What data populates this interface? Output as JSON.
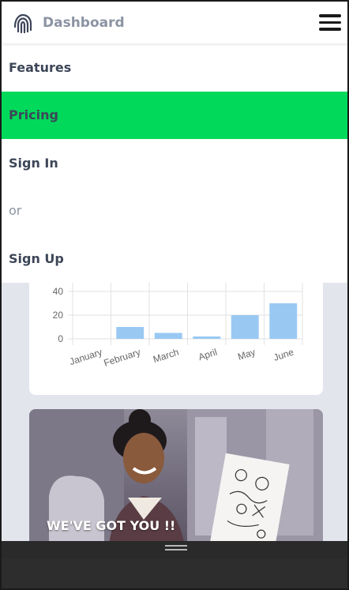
{
  "header": {
    "brand": "Dashboard",
    "logo_icon": "fingerprint-icon",
    "menu_icon": "hamburger-menu-icon"
  },
  "menu": {
    "items": [
      {
        "label": "Features"
      },
      {
        "label": "Pricing",
        "active": true
      },
      {
        "label": "Sign In"
      },
      {
        "label": "or"
      },
      {
        "label": "Sign Up"
      }
    ]
  },
  "chart_data": {
    "type": "bar",
    "categories": [
      "January",
      "February",
      "March",
      "April",
      "May",
      "June"
    ],
    "values": [
      0,
      10,
      5,
      2,
      20,
      30
    ],
    "y_ticks": [
      0,
      20,
      40
    ],
    "ylim": [
      0,
      40
    ],
    "grid": true,
    "bar_color": "#99c9f3"
  },
  "promo": {
    "text": "WE'VE GOT YOU !!"
  },
  "colors": {
    "accent": "#00d95a",
    "menu_text": "#3d4658",
    "muted_text": "#8b93a3",
    "page_bg": "#e3e5ec"
  }
}
